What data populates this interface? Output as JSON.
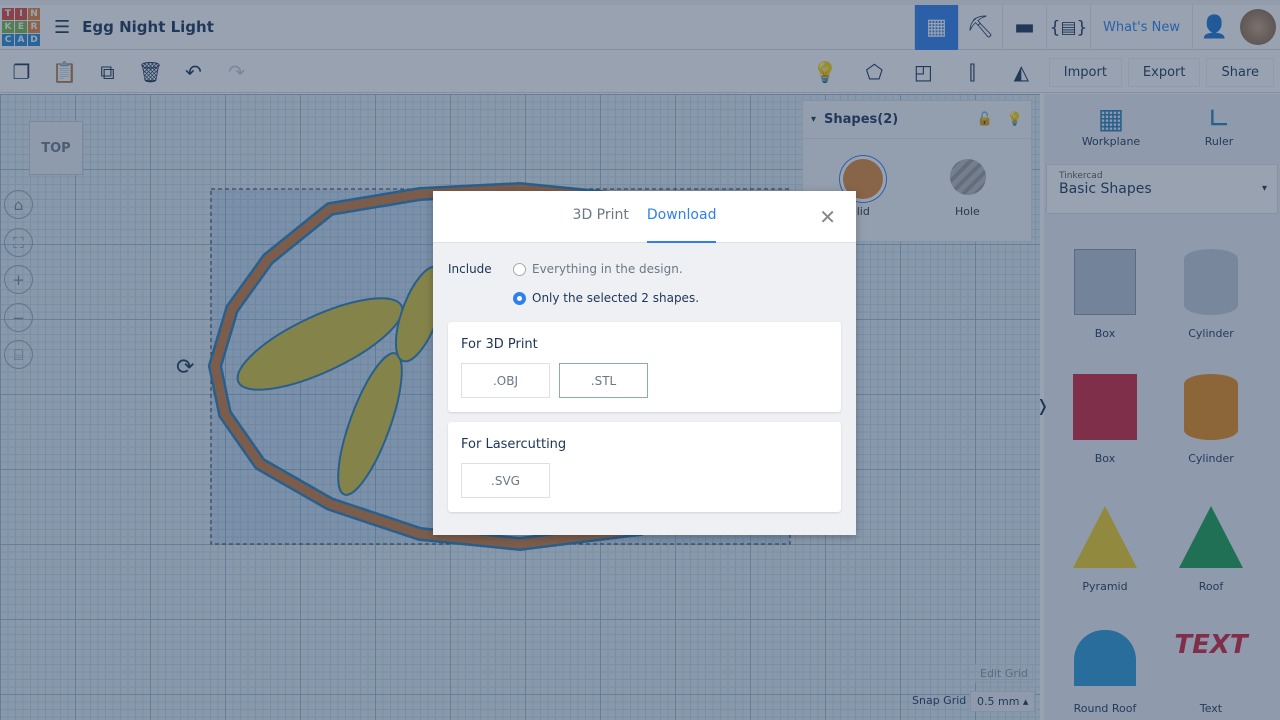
{
  "app": {
    "logo_letters": [
      "T",
      "I",
      "N",
      "K",
      "E",
      "R",
      "C",
      "A",
      "D"
    ],
    "design_title": "Egg Night Light"
  },
  "header": {
    "whats_new": "What's New"
  },
  "toolbar": {
    "import": "Import",
    "export": "Export",
    "share": "Share"
  },
  "canvas": {
    "view_cube": "TOP",
    "edit_grid": "Edit Grid",
    "snap_grid_label": "Snap Grid",
    "snap_grid_value": "0.5 mm"
  },
  "inspector": {
    "title": "Shapes(2)",
    "solid": "Solid",
    "hole": "Hole"
  },
  "sidebar": {
    "workplane": "Workplane",
    "ruler": "Ruler",
    "library_source": "Tinkercad",
    "library_name": "Basic Shapes",
    "shapes": [
      {
        "label": "Box",
        "color": "#b8c4d4"
      },
      {
        "label": "Cylinder",
        "color": "#c4ccd8"
      },
      {
        "label": "Box",
        "color": "#d0243a"
      },
      {
        "label": "Cylinder",
        "color": "#e88a1a"
      },
      {
        "label": "Pyramid",
        "color": "#f2d024"
      },
      {
        "label": "Roof",
        "color": "#1aa050"
      },
      {
        "label": "Round Roof",
        "color": "#2a9ad6"
      },
      {
        "label": "Text",
        "color": "#d0243a"
      }
    ]
  },
  "modal": {
    "tabs": [
      "3D Print",
      "Download"
    ],
    "active_tab": "Download",
    "include_label": "Include",
    "options": [
      {
        "label": "Everything in the design.",
        "selected": false
      },
      {
        "label": "Only the selected 2 shapes.",
        "selected": true
      }
    ],
    "print_section": "For 3D Print",
    "print_formats": [
      ".OBJ",
      ".STL"
    ],
    "laser_section": "For Lasercutting",
    "laser_formats": [
      ".SVG"
    ]
  }
}
